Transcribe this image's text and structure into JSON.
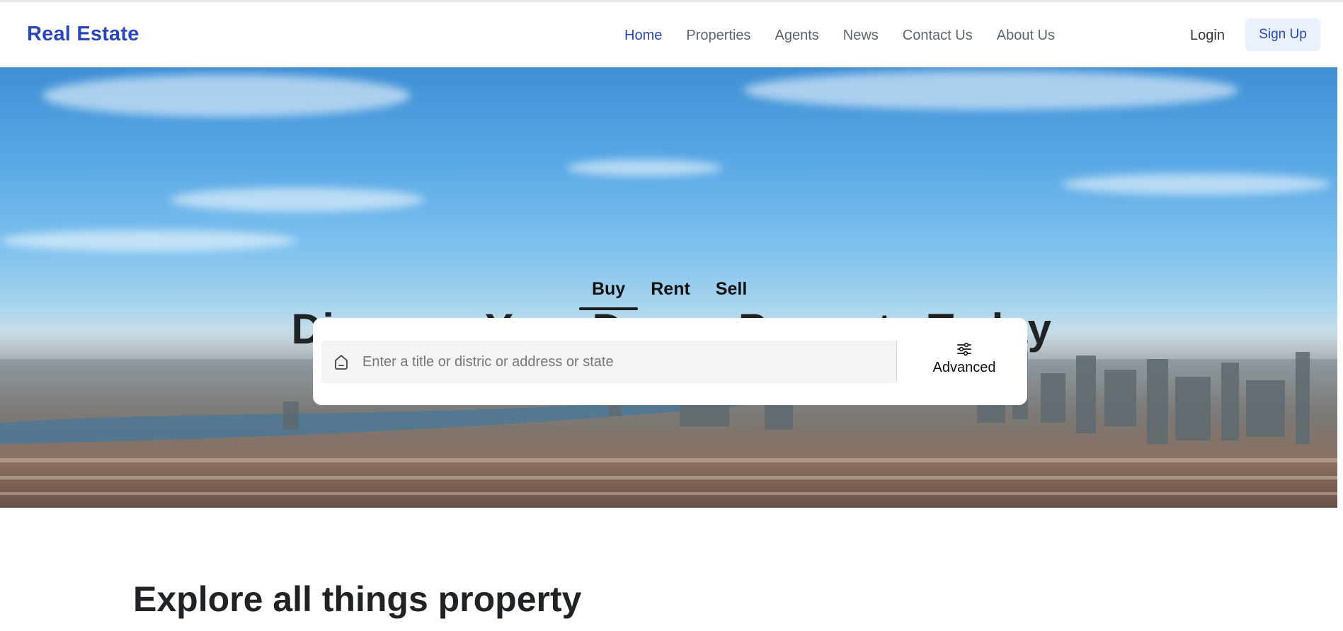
{
  "header": {
    "brand": "Real Estate",
    "nav": [
      {
        "label": "Home",
        "active": true
      },
      {
        "label": "Properties",
        "active": false
      },
      {
        "label": "Agents",
        "active": false
      },
      {
        "label": "News",
        "active": false
      },
      {
        "label": "Contact Us",
        "active": false
      },
      {
        "label": "About Us",
        "active": false
      }
    ],
    "login_label": "Login",
    "signup_label": "Sign Up"
  },
  "hero": {
    "title": "Discover Your Dream Property Today",
    "tabs": [
      {
        "label": "Buy",
        "active": true
      },
      {
        "label": "Rent",
        "active": false
      },
      {
        "label": "Sell",
        "active": false
      }
    ],
    "search": {
      "placeholder": "Enter a title or distric or address or state",
      "value": "",
      "icon": "home-icon"
    },
    "advanced_label": "Advanced",
    "advanced_icon": "sliders-icon"
  },
  "section": {
    "title": "Explore all things property"
  },
  "colors": {
    "brand": "#2a46b8",
    "nav_text": "#5b6470",
    "signup_bg": "#eaf0fc"
  }
}
